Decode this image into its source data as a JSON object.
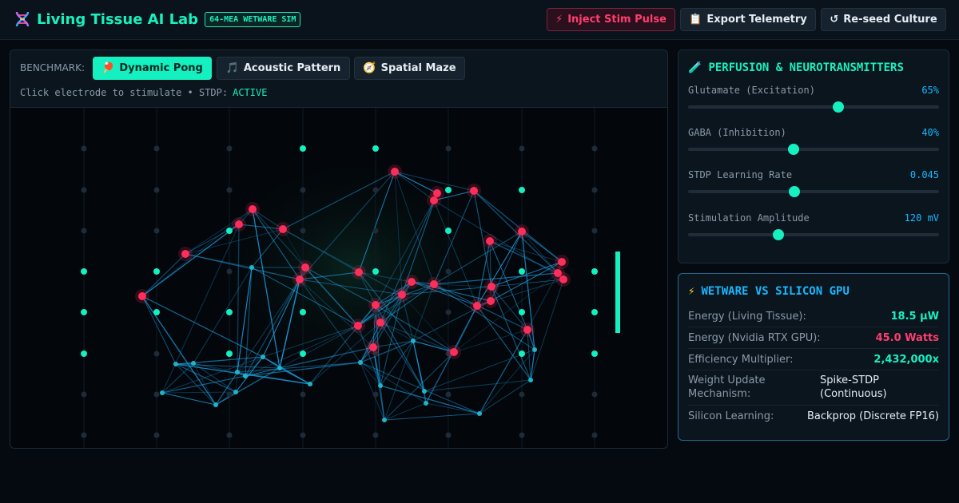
{
  "header": {
    "title": "Living Tissue AI Lab",
    "badge": "64-MEA WETWARE SIM",
    "logo_icon": "dna-icon",
    "buttons": [
      {
        "label": "Inject Stim Pulse",
        "icon": "lightning-icon",
        "glyph": "⚡"
      },
      {
        "label": "Export Telemetry",
        "icon": "clipboard-icon",
        "glyph": "📋"
      },
      {
        "label": "Re-seed Culture",
        "icon": "refresh-icon",
        "glyph": "↺"
      }
    ]
  },
  "benchmark": {
    "label": "BENCHMARK:",
    "tabs": [
      {
        "label": "Dynamic Pong",
        "icon": "ping-pong-icon",
        "glyph": "🏓",
        "active": true
      },
      {
        "label": "Acoustic Pattern",
        "icon": "music-note-icon",
        "glyph": "🎵",
        "active": false
      },
      {
        "label": "Spatial Maze",
        "icon": "compass-icon",
        "glyph": "🧭",
        "active": false
      }
    ],
    "hint": "Click electrode to stimulate • STDP:",
    "stdp_status": "ACTIVE"
  },
  "perfusion": {
    "title": "PERFUSION & NEUROTRANSMITTERS",
    "icon": "test-tube-icon",
    "glyph": "🧪",
    "sliders": [
      {
        "label": "Glutamate (Excitation)",
        "value_text": "65%",
        "level": 0.6
      },
      {
        "label": "GABA (Inhibition)",
        "value_text": "40%",
        "level": 0.42
      },
      {
        "label": "STDP Learning Rate",
        "value_text": "0.045",
        "level": 0.425
      },
      {
        "label": "Stimulation Amplitude",
        "value_text": "120 mV",
        "level": 0.36
      }
    ]
  },
  "comparison": {
    "title": "WETWARE VS SILICON GPU",
    "icon": "lightning-icon",
    "glyph": "⚡",
    "rows": [
      {
        "label": "Energy (Living Tissue):",
        "value": "18.5 µW",
        "tone": "green"
      },
      {
        "label": "Energy (Nvidia RTX GPU):",
        "value": "45.0 Watts",
        "tone": "red"
      },
      {
        "label": "Efficiency Multiplier:",
        "value": "2,432,000x",
        "tone": "green"
      },
      {
        "label": "Weight Update Mechanism:",
        "value": "Spike-STDP (Continuous)",
        "tone": "white"
      },
      {
        "label": "Silicon Learning:",
        "value": "Backprop (Discrete FP16)",
        "tone": "white"
      }
    ]
  },
  "colors": {
    "accent": "#14f0c0",
    "spike": "#ff2d5a",
    "synapse": "#1ea3e8",
    "electrode_idle": "#1e2b38",
    "background": "#050a10"
  }
}
